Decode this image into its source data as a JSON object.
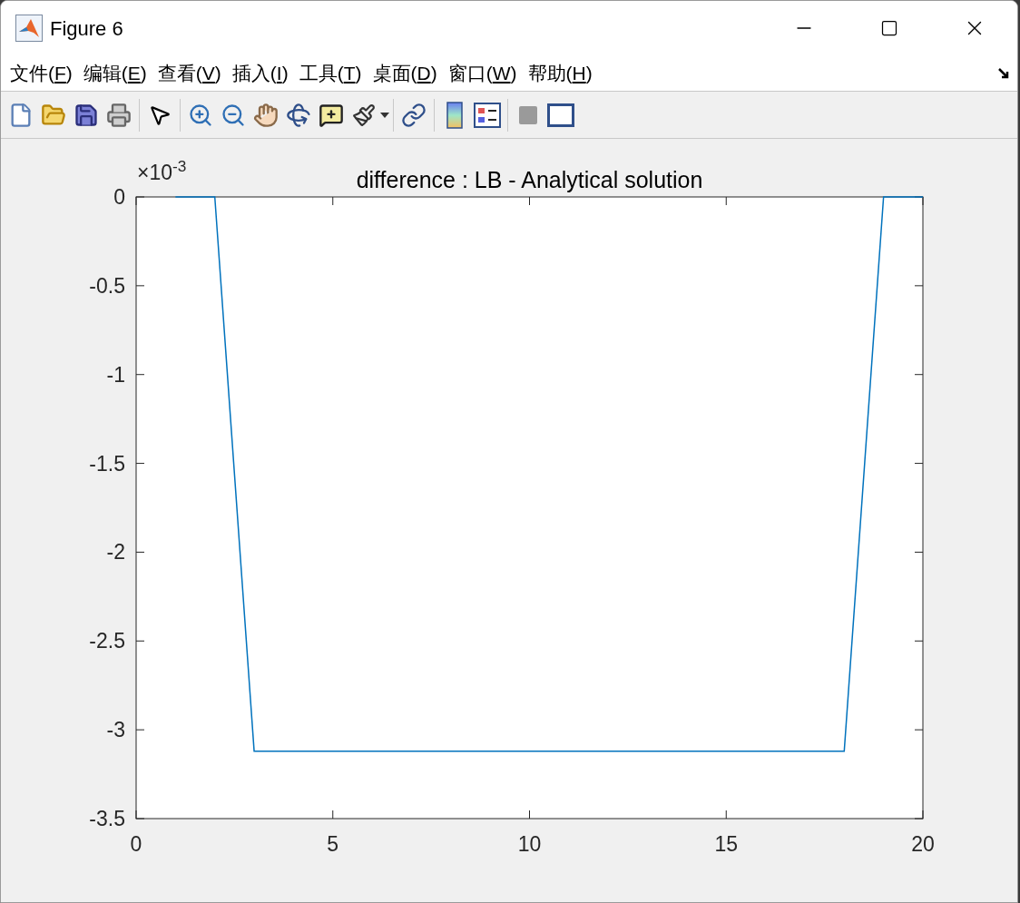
{
  "window": {
    "title": "Figure 6"
  },
  "menu": [
    {
      "prefix": "文件(",
      "key": "F",
      "suffix": ")"
    },
    {
      "prefix": "编辑(",
      "key": "E",
      "suffix": ")"
    },
    {
      "prefix": "查看(",
      "key": "V",
      "suffix": ")"
    },
    {
      "prefix": "插入(",
      "key": "I",
      "suffix": ")"
    },
    {
      "prefix": "工具(",
      "key": "T",
      "suffix": ")"
    },
    {
      "prefix": "桌面(",
      "key": "D",
      "suffix": ")"
    },
    {
      "prefix": "窗口(",
      "key": "W",
      "suffix": ")"
    },
    {
      "prefix": "帮助(",
      "key": "H",
      "suffix": ")"
    }
  ],
  "axes": {
    "exponent_label": "×10$^{-3}$",
    "chart_data": {
      "type": "line",
      "title": "difference : LB - Analytical solution",
      "x": [
        1,
        2,
        3,
        4,
        5,
        6,
        7,
        8,
        9,
        10,
        11,
        12,
        13,
        14,
        15,
        16,
        17,
        18,
        19,
        20
      ],
      "series": [
        {
          "color": "#0072bd",
          "values": [
            0,
            0,
            -3.12,
            -3.12,
            -3.12,
            -3.12,
            -3.12,
            -3.12,
            -3.12,
            -3.12,
            -3.12,
            -3.12,
            -3.12,
            -3.12,
            -3.12,
            -3.12,
            -3.12,
            -3.12,
            0,
            0
          ]
        }
      ],
      "xlim": [
        0,
        20
      ],
      "ylim": [
        -3.5,
        0
      ],
      "xticks": [
        0,
        5,
        10,
        15,
        20
      ],
      "yticks": [
        {
          "value": -3.5,
          "label": "-3.5"
        },
        {
          "value": -3,
          "label": "-3"
        },
        {
          "value": -2.5,
          "label": "-2.5"
        },
        {
          "value": -2,
          "label": "-2"
        },
        {
          "value": -1.5,
          "label": "-1.5"
        },
        {
          "value": -1,
          "label": "-1"
        },
        {
          "value": -0.5,
          "label": "-0.5"
        },
        {
          "value": 0,
          "label": "0"
        }
      ]
    }
  }
}
